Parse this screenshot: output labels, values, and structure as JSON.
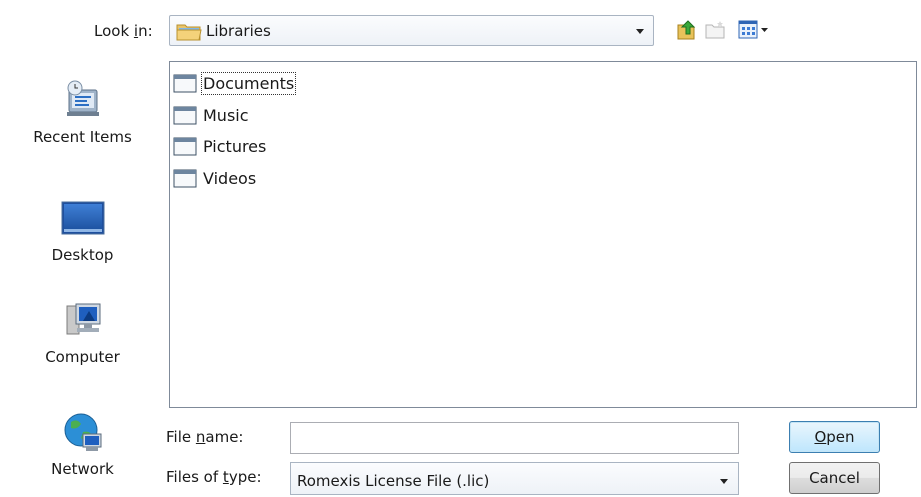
{
  "lookin": {
    "label_pre": "Look ",
    "label_key": "i",
    "label_post": "n:",
    "value": "Libraries"
  },
  "toolbar": {
    "up_icon": "up-one-level-icon",
    "new_folder_icon": "new-folder-icon",
    "view_icon": "view-menu-icon"
  },
  "places": [
    {
      "label": "Recent Items",
      "icon": "recent-items-icon"
    },
    {
      "label": "Desktop",
      "icon": "desktop-icon"
    },
    {
      "label": "Computer",
      "icon": "computer-icon"
    },
    {
      "label": "Network",
      "icon": "network-icon"
    }
  ],
  "files": [
    {
      "name": "Documents",
      "icon": "folder-icon"
    },
    {
      "name": "Music",
      "icon": "folder-icon"
    },
    {
      "name": "Pictures",
      "icon": "folder-icon"
    },
    {
      "name": "Videos",
      "icon": "folder-icon"
    }
  ],
  "filename": {
    "label_pre": "File ",
    "label_key": "n",
    "label_post": "ame:",
    "value": ""
  },
  "filetype": {
    "label_pre": "Files of ",
    "label_key": "t",
    "label_post": "ype:",
    "value": "Romexis License File (.lic)"
  },
  "buttons": {
    "open_key": "O",
    "open_rest": "pen",
    "cancel": "Cancel"
  },
  "colors": {
    "open_button_border": "#3c7fb1",
    "list_border": "#7f8a99"
  }
}
